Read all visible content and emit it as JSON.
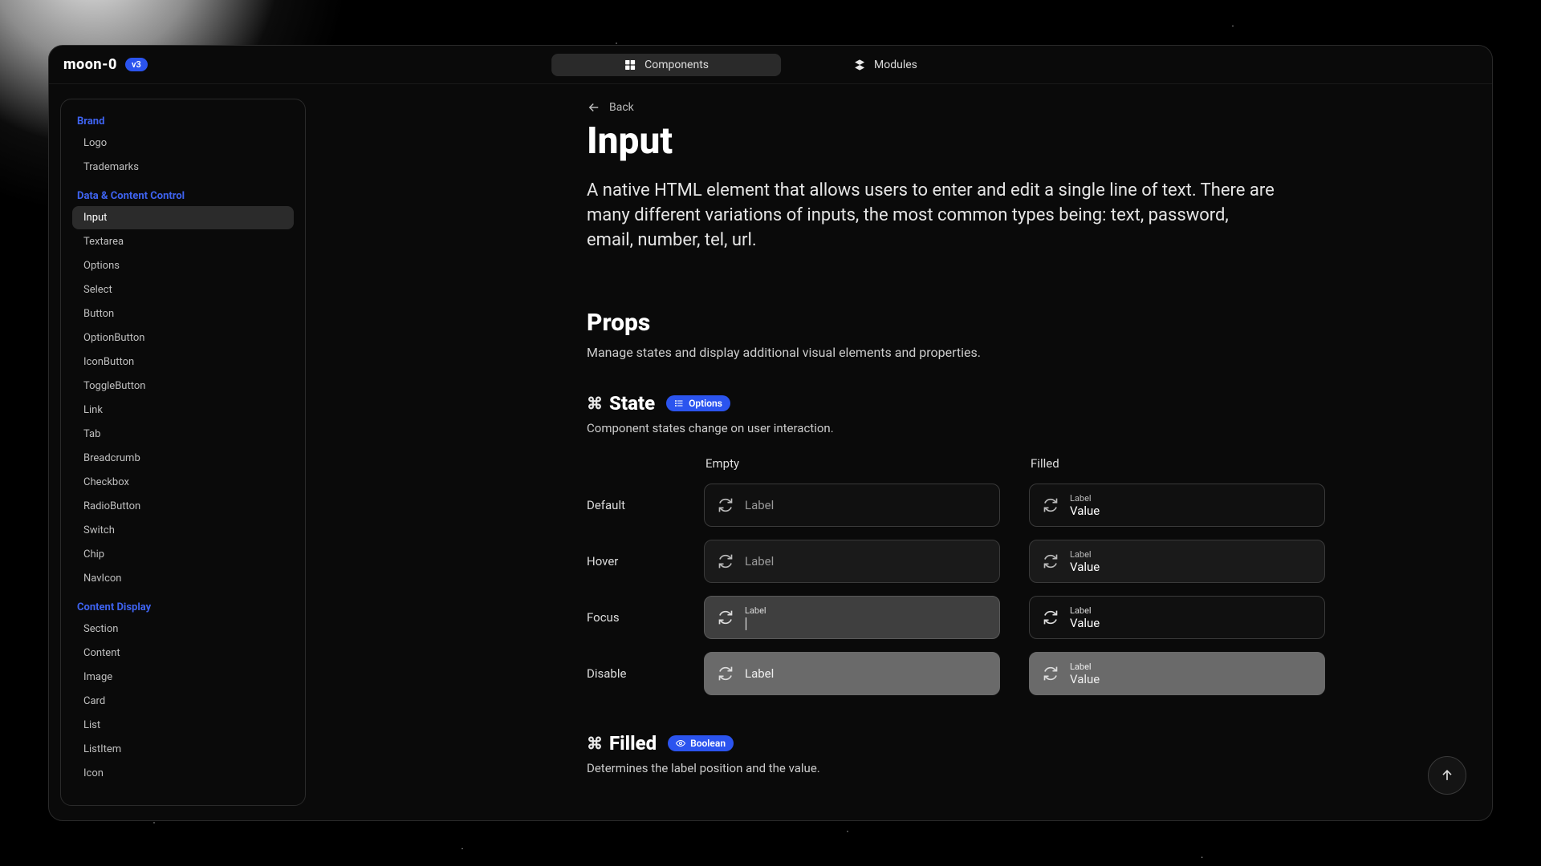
{
  "brand": {
    "logotype": "moon-0",
    "version": "v3"
  },
  "nav": {
    "components": "Components",
    "modules": "Modules"
  },
  "sidebar": {
    "sections": [
      {
        "title": "Brand",
        "items": [
          "Logo",
          "Trademarks"
        ]
      },
      {
        "title": "Data & Content Control",
        "items": [
          "Input",
          "Textarea",
          "Options",
          "Select",
          "Button",
          "OptionButton",
          "IconButton",
          "ToggleButton",
          "Link",
          "Tab",
          "Breadcrumb",
          "Checkbox",
          "RadioButton",
          "Switch",
          "Chip",
          "NavIcon"
        ]
      },
      {
        "title": "Content Display",
        "items": [
          "Section",
          "Content",
          "Image",
          "Card",
          "List",
          "ListItem",
          "Icon"
        ]
      }
    ],
    "active": "Input"
  },
  "back": "Back",
  "title": "Input",
  "description": "A native HTML element that allows users to enter and edit a single line of text. There are many different variations of inputs, the most common types being: text, password, email, number, tel, url.",
  "props": {
    "heading": "Props",
    "sub": "Manage states and display additional visual elements and properties."
  },
  "state": {
    "cmd": "⌘",
    "name": "State",
    "badge": "Options",
    "desc": "Component states change on user interaction.",
    "cols": {
      "empty": "Empty",
      "filled": "Filled"
    },
    "rows": {
      "default": "Default",
      "hover": "Hover",
      "focus": "Focus",
      "disable": "Disable"
    },
    "field": {
      "label": "Label",
      "value": "Value"
    }
  },
  "filled": {
    "cmd": "⌘",
    "name": "Filled",
    "badge": "Boolean",
    "desc": "Determines the label position and the value."
  }
}
